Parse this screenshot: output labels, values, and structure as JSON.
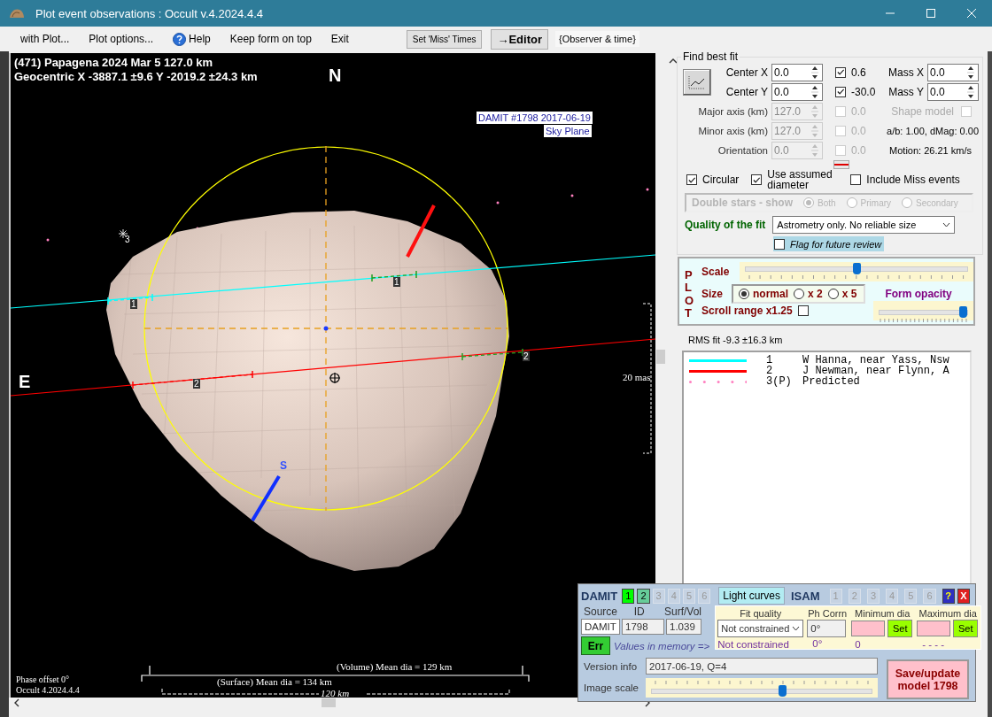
{
  "window": {
    "title": "Plot event observations : Occult v.4.2024.4.4"
  },
  "menu": [
    {
      "label": "with Plot...",
      "kind": "plain"
    },
    {
      "label": "Plot options...",
      "kind": "plain"
    },
    {
      "label": "Help",
      "kind": "help"
    },
    {
      "label": "Keep form on top",
      "kind": "plain"
    },
    {
      "label": "Exit",
      "kind": "plain"
    }
  ],
  "toolbar": {
    "miss_button": "Set 'Miss' Times",
    "editor_button": "→Editor",
    "observer_label": "{Observer & time}"
  },
  "plot": {
    "title_lines": [
      "(471) Papagena  2024 Mar 5   127.0 km",
      "Geocentric  X  -3887.1 ±9.6  Y -2019.2 ±24.3 km"
    ],
    "north": "N",
    "east": "E",
    "south": "S",
    "model_tags": [
      "DAMIT #1798 2017-06-19",
      "Sky Plane"
    ],
    "chords": [
      {
        "labels": [
          "1",
          "1"
        ]
      },
      {
        "labels": [
          "2",
          "2"
        ]
      }
    ],
    "star_label": "3",
    "scale_label": "20 mas",
    "volume_label": "(Volume) Mean dia = 129 km",
    "surface_label": "(Surface) Mean dia = 134 km",
    "length_label": "120 km",
    "footer_lines": [
      "Phase offset 0°",
      "Occult 4.2024.4.4"
    ]
  },
  "best_fit": {
    "title": "Find best fit",
    "rows": [
      {
        "label": "Center X",
        "value": "0.0",
        "disabled": false,
        "check": {
          "label": "0.6",
          "checked": true,
          "disabled": false
        }
      },
      {
        "label": "Center Y",
        "value": "0.0",
        "disabled": false,
        "check": {
          "label": "-30.0",
          "checked": true,
          "disabled": false
        }
      },
      {
        "label": "Major axis (km)",
        "value": "127.0",
        "disabled": true,
        "check": {
          "label": "0.0",
          "checked": false,
          "disabled": true
        }
      },
      {
        "label": "Minor axis (km)",
        "value": "127.0",
        "disabled": true,
        "check": {
          "label": "0.0",
          "checked": false,
          "disabled": true
        }
      },
      {
        "label": "Orientation",
        "value": "0.0",
        "disabled": true,
        "check": {
          "label": "0.0",
          "checked": false,
          "disabled": true
        }
      }
    ],
    "mass": [
      {
        "label": "Mass X",
        "value": "0.0"
      },
      {
        "label": "Mass Y",
        "value": "0.0"
      }
    ],
    "shape_model": {
      "label": "Shape model",
      "checked": false,
      "disabled": true
    },
    "ratio_text": "a/b: 1.00, dMag: 0.00",
    "motion_text": "Motion: 26.21 km/s",
    "options": [
      {
        "label": "Circular",
        "checked": true
      },
      {
        "label": "Use assumed diameter",
        "checked": true
      },
      {
        "label": "Include Miss events",
        "checked": false
      }
    ],
    "double_stars": {
      "label": "Double stars - show",
      "disabled": true,
      "options": [
        {
          "label": "Both",
          "selected": true
        },
        {
          "label": "Primary",
          "selected": false
        },
        {
          "label": "Secondary",
          "selected": false
        }
      ]
    },
    "quality": {
      "label": "Quality of the fit",
      "value": "Astrometry only. No reliable size"
    },
    "flag": {
      "label": "Flag for future review",
      "checked": false
    }
  },
  "plot_controls": {
    "side_label": "PLOT",
    "scale": {
      "label": "Scale",
      "level": 0.5
    },
    "size": {
      "label": "Size",
      "options": [
        {
          "label": "normal",
          "selected": true
        },
        {
          "label": "x 2",
          "selected": false
        },
        {
          "label": "x 5",
          "selected": false
        }
      ]
    },
    "opacity": {
      "label": "Form opacity",
      "level": 1.0
    },
    "scroll_range": {
      "label": "Scroll range x1.25",
      "checked": false
    }
  },
  "rms_text": "RMS fit -9.3 ±16.3 km",
  "legend": [
    {
      "kind": "line",
      "color": "#00ffff",
      "number": "1",
      "name": "W Hanna, near Yass, Nsw"
    },
    {
      "kind": "line",
      "color": "#ff0000",
      "number": "2",
      "name": "J Newman, near Flynn, A"
    },
    {
      "kind": "dots",
      "color": "#ff80c0",
      "number": "3(P)",
      "name": "Predicted"
    }
  ],
  "damit": {
    "title": "DAMIT",
    "models": [
      {
        "label": "1",
        "selected": true,
        "disabled": false
      },
      {
        "label": "2",
        "selected": false,
        "disabled": false
      },
      {
        "label": "3",
        "selected": false,
        "disabled": true
      },
      {
        "label": "4",
        "selected": false,
        "disabled": true
      },
      {
        "label": "5",
        "selected": false,
        "disabled": true
      },
      {
        "label": "6",
        "selected": false,
        "disabled": true
      }
    ],
    "light_curves": "Light curves",
    "isam_title": "ISAM",
    "isam_models": [
      {
        "label": "1",
        "disabled": true
      },
      {
        "label": "2",
        "disabled": true
      },
      {
        "label": "3",
        "disabled": true
      },
      {
        "label": "4",
        "disabled": true
      },
      {
        "label": "5",
        "disabled": true
      },
      {
        "label": "6",
        "disabled": true
      }
    ],
    "help": "?",
    "close": "X",
    "source": {
      "label": "Source",
      "value": "DAMIT"
    },
    "id": {
      "label": "ID",
      "value": "1798"
    },
    "surf_vol": {
      "label": "Surf/Vol",
      "value": "1.039"
    },
    "err_button": "Err",
    "memory_label": "Values in memory =>",
    "fit_quality": {
      "label": "Fit quality",
      "value": "Not constrained",
      "memory": "Not constrained"
    },
    "ph_corr": {
      "label": "Ph Corrn",
      "value": "0°",
      "memory": "0°"
    },
    "min_dia": {
      "label": "Minimum dia",
      "button": "Set",
      "memory": "0"
    },
    "max_dia": {
      "label": "Maximum dia",
      "button": "Set",
      "memory": "- - - -"
    },
    "version": {
      "label": "Version info",
      "value": "2017-06-19, Q=4"
    },
    "image_scale": {
      "label": "Image scale",
      "level": 0.6
    },
    "save_button": "Save/update model 1798"
  }
}
